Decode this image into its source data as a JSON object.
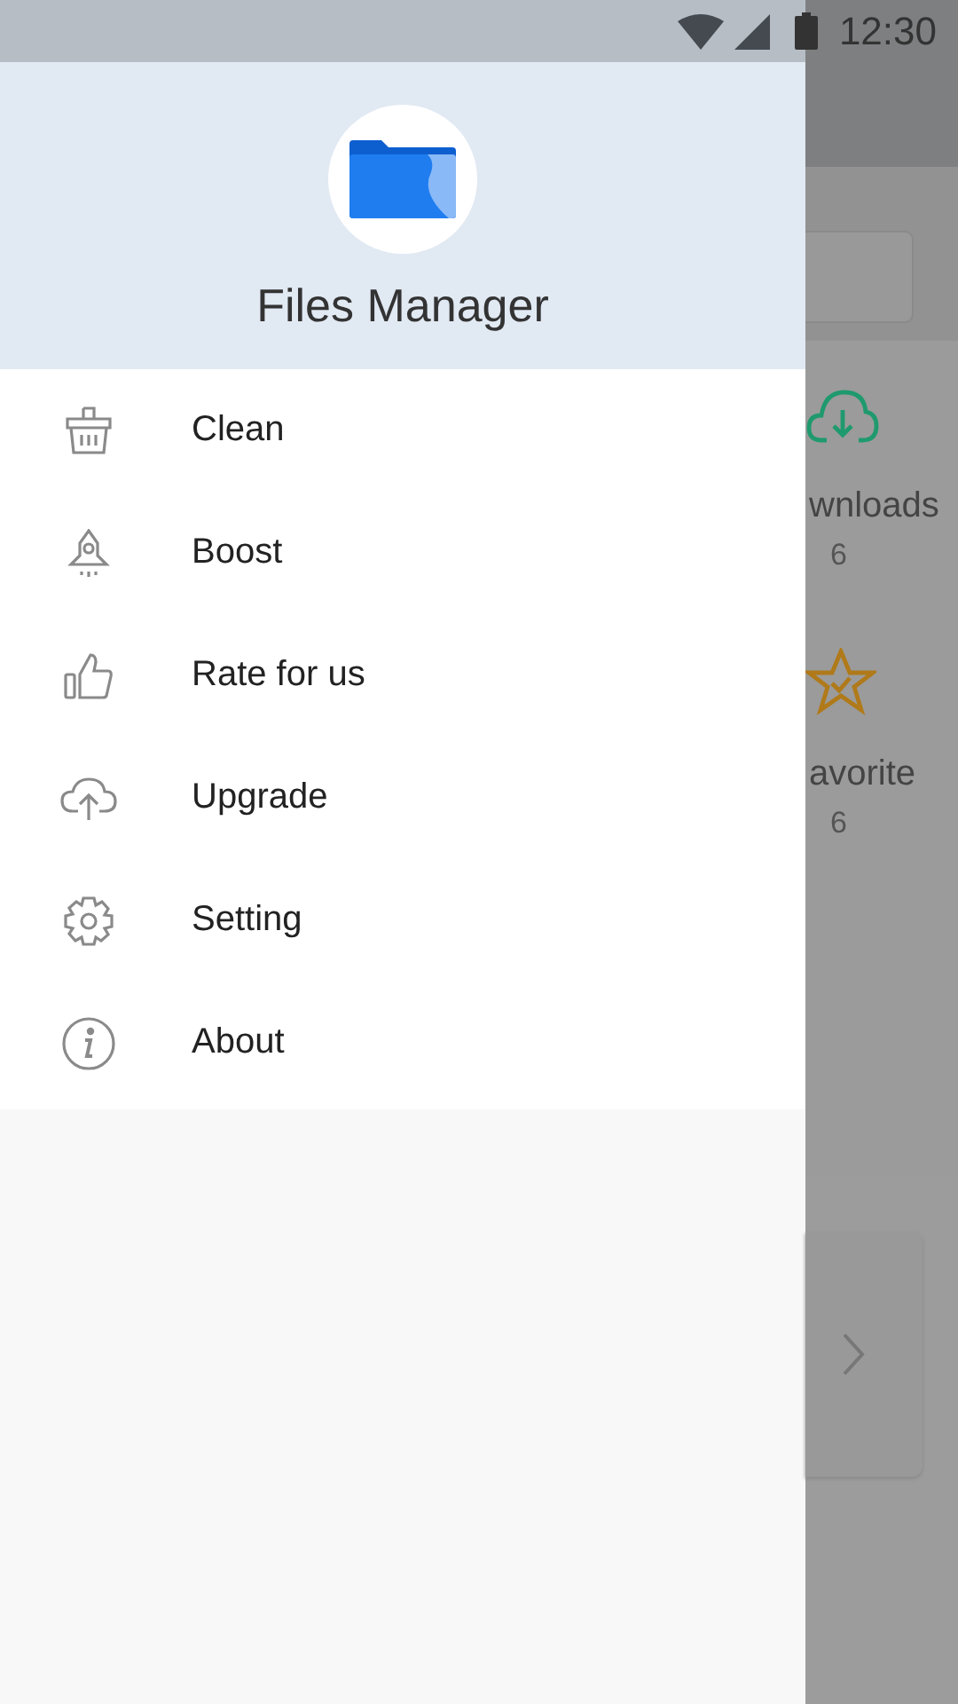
{
  "status_bar": {
    "time": "12:30"
  },
  "drawer": {
    "title": "Files Manager",
    "items": [
      {
        "kind": "clean",
        "label": "Clean"
      },
      {
        "kind": "boost",
        "label": "Boost"
      },
      {
        "kind": "rate",
        "label": "Rate for us"
      },
      {
        "kind": "upgrade",
        "label": "Upgrade"
      },
      {
        "kind": "setting",
        "label": "Setting"
      },
      {
        "kind": "about",
        "label": "About"
      }
    ]
  },
  "background": {
    "categories": [
      {
        "kind": "downloads",
        "label": "wnloads",
        "count": "6"
      },
      {
        "kind": "favorite",
        "label": "avorite",
        "count": "6"
      }
    ]
  }
}
